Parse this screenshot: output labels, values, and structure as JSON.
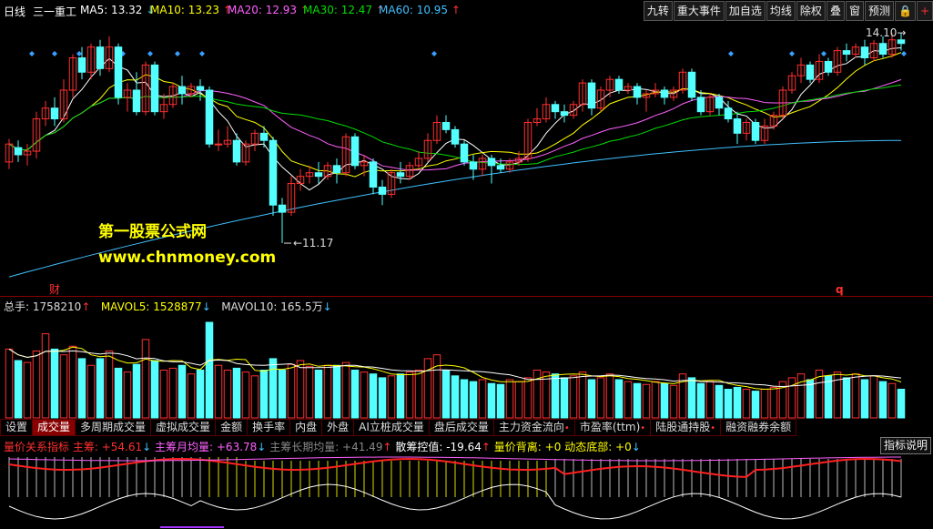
{
  "header": {
    "period_label": "日线",
    "stock_name": "三一重工",
    "ma": [
      {
        "label": "MA5: 13.32",
        "arrow": "↓",
        "color": "#ffffff",
        "arrow_color": "#40c0ff"
      },
      {
        "label": "MA10: 13.23",
        "arrow": "↑",
        "color": "#ffff00",
        "arrow_color": "#ff3030"
      },
      {
        "label": "MA20: 12.93",
        "arrow": "↑",
        "color": "#ff60ff",
        "arrow_color": "#ff3030"
      },
      {
        "label": "MA30: 12.47",
        "arrow": "↑",
        "color": "#00dd00",
        "arrow_color": "#ff3030"
      },
      {
        "label": "MA60: 10.95",
        "arrow": "↑",
        "color": "#40c0ff",
        "arrow_color": "#ff3030"
      }
    ],
    "buttons": [
      "九转",
      "重大事件",
      "加自选",
      "均线",
      "除权",
      "叠",
      "窗",
      "预测",
      "🔒",
      "+"
    ]
  },
  "price_chart": {
    "high_label": "14.10",
    "low_label": "11.17",
    "marker_cai": "财",
    "marker_q": "q",
    "watermark_title": "第一股票公式网",
    "watermark_url": "www.chnmoney.com",
    "up_color": "#ff3030",
    "down_color": "#54ffff"
  },
  "volume": {
    "total": {
      "label": "总手: 1758210",
      "arrow": "↑"
    },
    "mavol5": {
      "label": "MAVOL5: 1528877",
      "arrow": "↓"
    },
    "mavol10": {
      "label": "MAVOL10: 165.5万",
      "arrow": "↓"
    }
  },
  "tabs": [
    {
      "label": "设置",
      "active": false,
      "dot": false
    },
    {
      "label": "成交量",
      "active": true,
      "dot": false
    },
    {
      "label": "多周期成交量",
      "active": false,
      "dot": false
    },
    {
      "label": "虚拟成交量",
      "active": false,
      "dot": false
    },
    {
      "label": "金额",
      "active": false,
      "dot": false
    },
    {
      "label": "换手率",
      "active": false,
      "dot": false
    },
    {
      "label": "内盘",
      "active": false,
      "dot": false
    },
    {
      "label": "外盘",
      "active": false,
      "dot": false
    },
    {
      "label": "AI立桩成交量",
      "active": false,
      "dot": false
    },
    {
      "label": "盘后成交量",
      "active": false,
      "dot": false
    },
    {
      "label": "主力资金流向",
      "active": false,
      "dot": true
    },
    {
      "label": "市盈率(ttm)",
      "active": false,
      "dot": true
    },
    {
      "label": "陆股通持股",
      "active": false,
      "dot": true
    },
    {
      "label": "融资融券余额",
      "active": false,
      "dot": false
    }
  ],
  "indicator": {
    "name": "量价关系指标",
    "items": [
      {
        "label": "主筹: +54.61",
        "arrow": "↓",
        "color": "#ff3030",
        "arrow_color": "#40c0ff"
      },
      {
        "label": "主筹月均量: +63.78",
        "arrow": "↓",
        "color": "#ff60ff",
        "arrow_color": "#40c0ff"
      },
      {
        "label": "主筹长期均量: +41.49",
        "arrow": "↑",
        "color": "#888888",
        "arrow_color": "#ff3030"
      },
      {
        "label": "散筹控值: -19.64",
        "arrow": "↑",
        "color": "#ffffff",
        "arrow_color": "#ff3030"
      },
      {
        "label": "量价背离: +0",
        "arrow": "",
        "color": "#ffff00",
        "arrow_color": "#ffff00"
      },
      {
        "label": "动态底部: +0",
        "arrow": "↓",
        "color": "#ffff00",
        "arrow_color": "#40c0ff"
      }
    ],
    "help_button": "指标说明"
  }
}
